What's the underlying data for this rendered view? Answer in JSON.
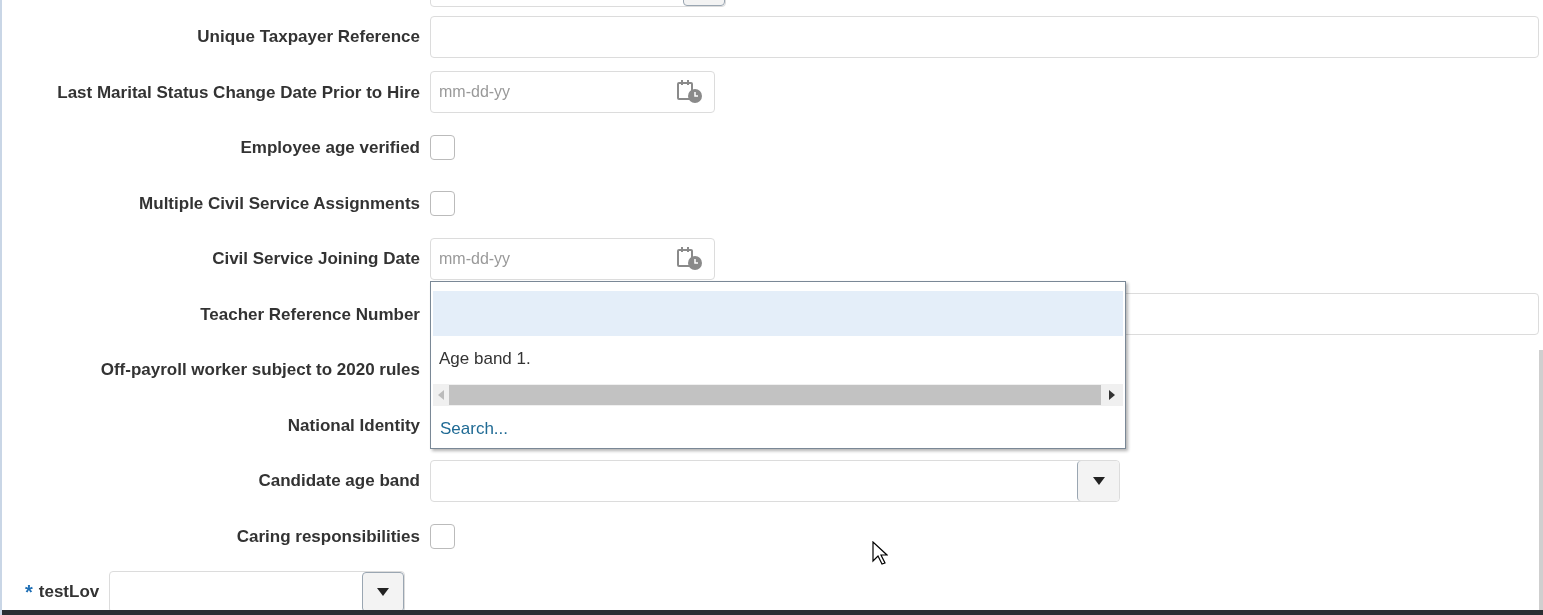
{
  "rows": [
    {
      "kind": "text",
      "label": "Unique Taxpayer Reference"
    },
    {
      "kind": "date",
      "label": "Last Marital Status Change Date Prior to Hire",
      "placeholder": "mm-dd-yy"
    },
    {
      "kind": "checkbox",
      "label": "Employee age verified",
      "checked": false
    },
    {
      "kind": "checkbox",
      "label": "Multiple Civil Service Assignments",
      "checked": false
    },
    {
      "kind": "date",
      "label": "Civil Service Joining Date",
      "placeholder": "mm-dd-yy"
    },
    {
      "kind": "text",
      "label": "Teacher Reference Number"
    },
    {
      "kind": "covered",
      "label": "Off-payroll worker subject to 2020 rules"
    },
    {
      "kind": "covered",
      "label": "National Identity"
    },
    {
      "kind": "select",
      "label": "Candidate age band"
    },
    {
      "kind": "checkbox",
      "label": "Caring responsibilities",
      "checked": false
    },
    {
      "kind": "lov",
      "label": "testLov",
      "required_mark": "*"
    }
  ],
  "popup": {
    "options": [
      {
        "selected": true
      },
      {
        "label": "Age band 1.",
        "selected": false
      }
    ],
    "search_link": "Search..."
  }
}
